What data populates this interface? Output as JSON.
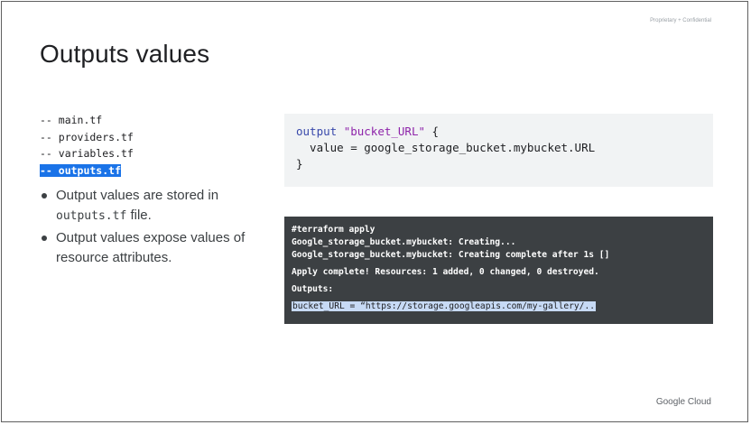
{
  "header": {
    "confidential_label": "Proprietary + Confidential"
  },
  "slide": {
    "title": "Outputs values"
  },
  "file_tree": {
    "items": [
      {
        "label": "-- main.tf",
        "selected": false
      },
      {
        "label": "-- providers.tf",
        "selected": false
      },
      {
        "label": "-- variables.tf",
        "selected": false
      },
      {
        "label": "-- outputs.tf",
        "selected": true
      }
    ]
  },
  "bullets": {
    "first_prefix": "Output values are stored in",
    "first_code": "outputs.tf",
    "first_suffix": " file.",
    "second": "Output values expose values of resource attributes."
  },
  "code_block": {
    "keyword": "output",
    "name": "\"bucket_URL\"",
    "open_brace": " {",
    "body": "  value = google_storage_bucket.mybucket.URL",
    "close_brace": "}"
  },
  "terminal": {
    "lines": [
      "#terraform apply",
      "Google_storage_bucket.mybucket: Creating...",
      "Google_storage_bucket.mybucket: Creating complete after 1s []",
      "Apply complete! Resources: 1 added, 0 changed, 0 destroyed.",
      "Outputs:",
      "bucket_URL = “https://storage.googleapis.com/my-gallery/.."
    ]
  },
  "footer": {
    "brand": "Google Cloud"
  },
  "colors": {
    "selection": "#1a73e8",
    "terminal_bg": "#3c4043",
    "code_bg": "#f1f3f4",
    "highlight": "#c7daf5"
  }
}
